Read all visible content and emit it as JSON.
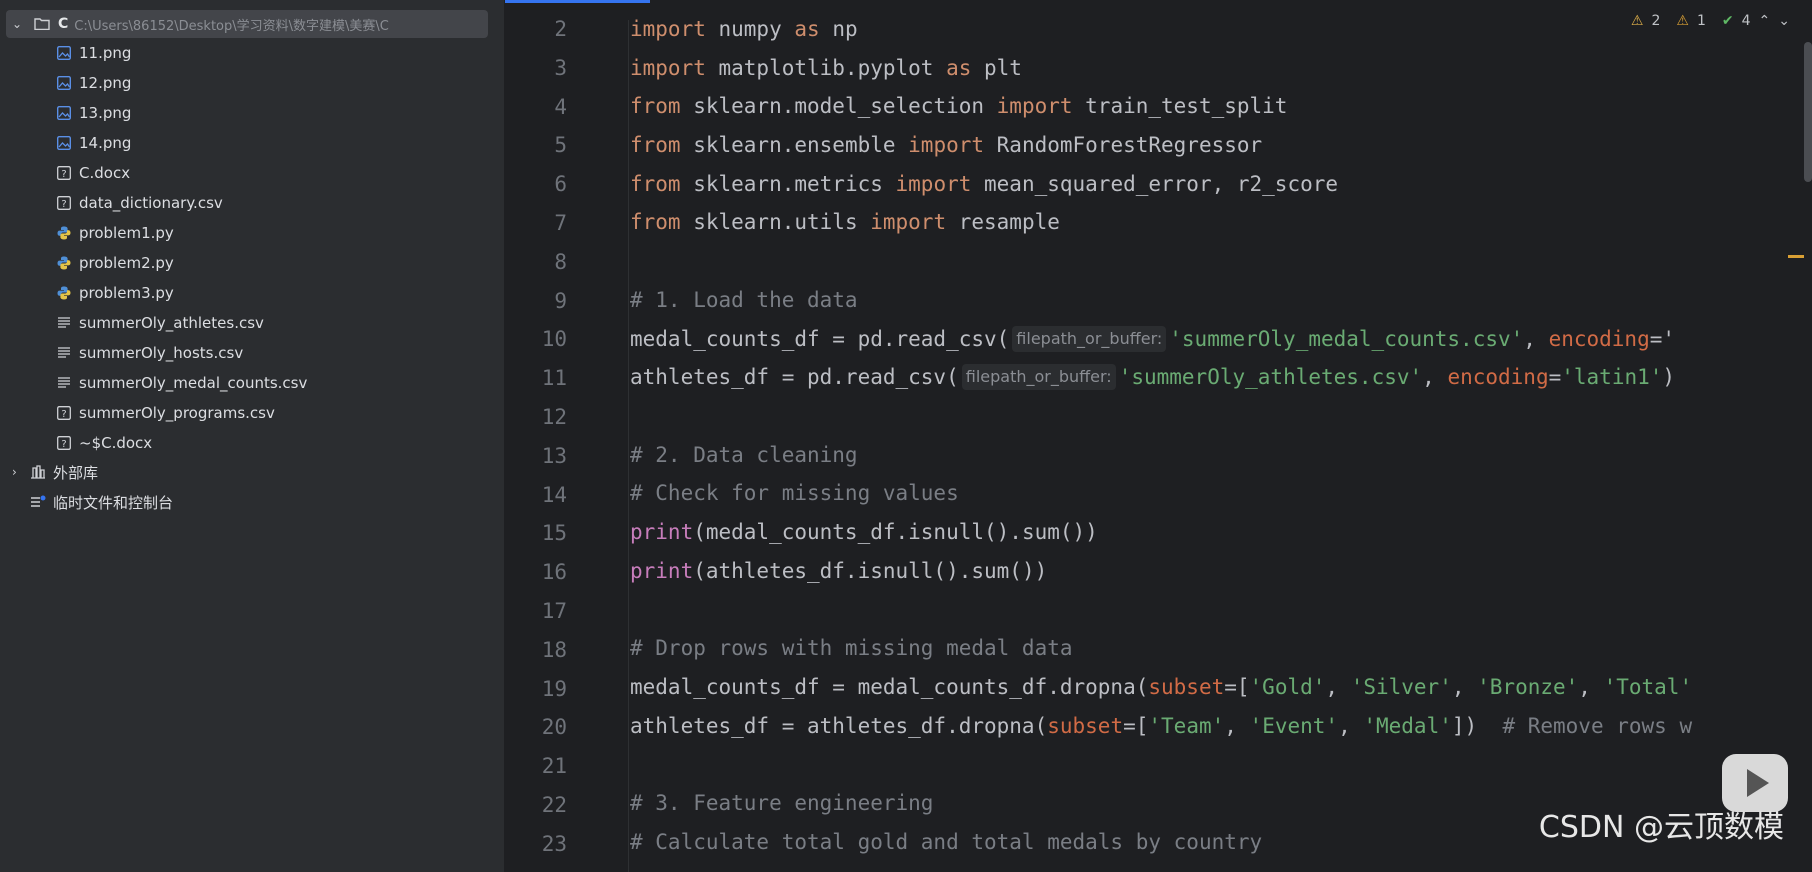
{
  "project": {
    "root_name": "C",
    "root_path": "C:\\Users\\86152\\Desktop\\学习资料\\数字建模\\美赛\\C",
    "files": [
      {
        "name": "11.png",
        "icon": "image-icon"
      },
      {
        "name": "12.png",
        "icon": "image-icon"
      },
      {
        "name": "13.png",
        "icon": "image-icon"
      },
      {
        "name": "14.png",
        "icon": "image-icon"
      },
      {
        "name": "C.docx",
        "icon": "unknown-file-icon"
      },
      {
        "name": "data_dictionary.csv",
        "icon": "unknown-file-icon"
      },
      {
        "name": "problem1.py",
        "icon": "python-icon"
      },
      {
        "name": "problem2.py",
        "icon": "python-icon"
      },
      {
        "name": "problem3.py",
        "icon": "python-icon"
      },
      {
        "name": "summerOly_athletes.csv",
        "icon": "text-file-icon"
      },
      {
        "name": "summerOly_hosts.csv",
        "icon": "text-file-icon"
      },
      {
        "name": "summerOly_medal_counts.csv",
        "icon": "text-file-icon"
      },
      {
        "name": "summerOly_programs.csv",
        "icon": "unknown-file-icon"
      },
      {
        "name": "~$C.docx",
        "icon": "unknown-file-icon"
      }
    ],
    "external_libs": "外部库",
    "scratches": "临时文件和控制台"
  },
  "inspections": {
    "errors": "2",
    "warnings": "1",
    "ok": "4"
  },
  "code": {
    "lines": [
      {
        "n": "2"
      },
      {
        "n": "3"
      },
      {
        "n": "4"
      },
      {
        "n": "5"
      },
      {
        "n": "6"
      },
      {
        "n": "7"
      },
      {
        "n": "8"
      },
      {
        "n": "9"
      },
      {
        "n": "10"
      },
      {
        "n": "11"
      },
      {
        "n": "12"
      },
      {
        "n": "13"
      },
      {
        "n": "14"
      },
      {
        "n": "15"
      },
      {
        "n": "16"
      },
      {
        "n": "17"
      },
      {
        "n": "18"
      },
      {
        "n": "19"
      },
      {
        "n": "20"
      },
      {
        "n": "21"
      },
      {
        "n": "22"
      },
      {
        "n": "23"
      }
    ],
    "l2": {
      "a": "import",
      "b": " numpy ",
      "c": "as",
      "d": " np"
    },
    "l3": {
      "a": "import",
      "b": " matplotlib.pyplot ",
      "c": "as",
      "d": " plt"
    },
    "l4": {
      "a": "from",
      "b": " sklearn.model_selection ",
      "c": "import",
      "d": " train_test_split"
    },
    "l5": {
      "a": "from",
      "b": " sklearn.ensemble ",
      "c": "import",
      "d": " RandomForestRegressor"
    },
    "l6": {
      "a": "from",
      "b": " sklearn.metrics ",
      "c": "import",
      "d": " mean_squared_error, r2_score"
    },
    "l7": {
      "a": "from",
      "b": " sklearn.utils ",
      "c": "import",
      "d": " resample"
    },
    "l9": "# 1. Load the data",
    "l10": {
      "a": "medal_counts_df = pd.read_csv(",
      "hint": "filepath_or_buffer:",
      "s": "'summerOly_medal_counts.csv'",
      "c": ", ",
      "k": "encoding",
      "e": "='"
    },
    "l11": {
      "a": "athletes_df = pd.read_csv(",
      "hint": "filepath_or_buffer:",
      "s": "'summerOly_athletes.csv'",
      "c": ", ",
      "k": "encoding",
      "e": "=",
      "s2": "'latin1'",
      "z": ")"
    },
    "l13": "# 2. Data cleaning",
    "l14": "# Check for missing values",
    "l15": {
      "f": "print",
      "a": "(medal_counts_df.isnull().sum())"
    },
    "l16": {
      "f": "print",
      "a": "(athletes_df.isnull().sum())"
    },
    "l18": "# Drop rows with missing medal data",
    "l19": {
      "a": "medal_counts_df = medal_counts_df.dropna(",
      "k": "subset",
      "b": "=[",
      "s1": "'Gold'",
      "c1": ", ",
      "s2": "'Silver'",
      "c2": ", ",
      "s3": "'Bronze'",
      "c3": ", ",
      "s4": "'Total'"
    },
    "l20": {
      "a": "athletes_df = athletes_df.dropna(",
      "k": "subset",
      "b": "=[",
      "s1": "'Team'",
      "c1": ", ",
      "s2": "'Event'",
      "c2": ", ",
      "s3": "'Medal'",
      "c3": "])  ",
      "cm": "# Remove rows w"
    },
    "l22": "# 3. Feature engineering",
    "l23": "# Calculate total gold and total medals by country"
  },
  "watermark": "CSDN @云顶数模",
  "colors": {
    "accent": "#3574f0",
    "keyword": "#cf8e6d",
    "string": "#6aab73",
    "comment": "#7a7e85",
    "kwarg": "#d16b46"
  }
}
